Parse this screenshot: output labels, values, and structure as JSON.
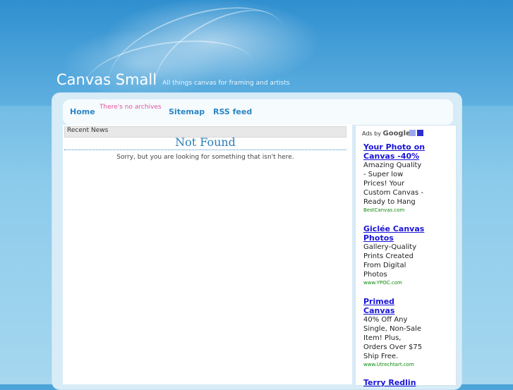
{
  "header": {
    "site_title": "Canvas Small",
    "tagline": "All things canvas for framing and artists"
  },
  "nav": {
    "items": [
      {
        "label": "Home"
      },
      {
        "label": "Sitemap"
      },
      {
        "label": "RSS feed"
      }
    ],
    "archives_note": "There's no archives"
  },
  "main": {
    "recent_label": "Recent News",
    "not_found_title": "Not Found",
    "not_found_message": "Sorry, but you are looking for something that isn't here."
  },
  "sidebar": {
    "ads_by": "Ads by",
    "google": "Google",
    "ads": [
      {
        "title": "Your Photo on Canvas -40%",
        "desc": "Amazing Quality - Super low Prices! Your Custom Canvas - Ready to Hang",
        "url": "BestCanvas.com"
      },
      {
        "title": "Giclée Canvas Photos",
        "desc": "Gallery-Quality Prints Created From Digital Photos",
        "url": "www.YPOC.com"
      },
      {
        "title": "Primed Canvas",
        "desc": "40% Off Any Single, Non-Sale Item! Plus, Orders Over $75 Ship Free.",
        "url": "www.Utrechtart.com"
      },
      {
        "title": "Terry Redlin",
        "desc": "",
        "url": ""
      }
    ]
  },
  "colors": {
    "link": "#2b86c3",
    "ad_title": "#1a14d8",
    "ad_url": "#0a8a0a",
    "archives_note": "#e0509a"
  }
}
